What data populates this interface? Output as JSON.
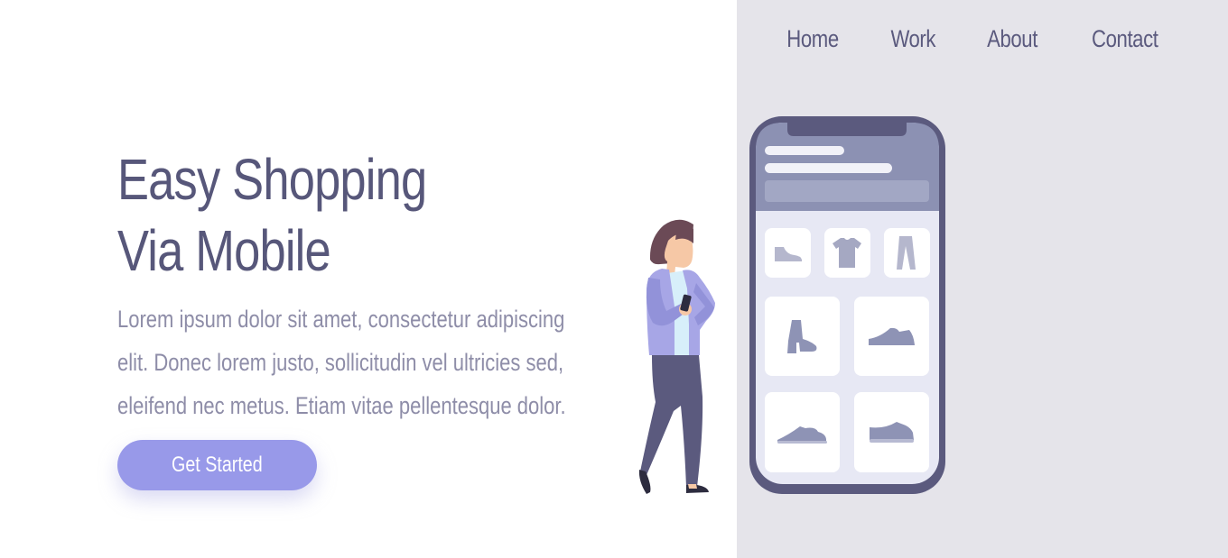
{
  "nav": {
    "items": [
      {
        "label": "Home"
      },
      {
        "label": "Work"
      },
      {
        "label": "About"
      },
      {
        "label": "Contact"
      }
    ]
  },
  "hero": {
    "title_line1": "Easy Shopping",
    "title_line2": "Via Mobile",
    "description": "Lorem ipsum dolor sit amet, consectetur adipiscing elit. Donec lorem justo, sollicitudin vel ultricies sed, eleifend nec metus. Etiam vitae pellentesque dolor.",
    "cta_label": "Get Started"
  },
  "illustration": {
    "person_icon": "woman-with-phone-icon",
    "phone_icon": "smartphone-shop-icon",
    "category_icons": [
      "shoe-icon",
      "tshirt-icon",
      "pants-icon"
    ],
    "product_icons": [
      "boot-icon",
      "sneaker-icon",
      "sneaker-icon",
      "sneaker-icon"
    ]
  },
  "colors": {
    "accent": "#9899e9",
    "text_dark": "#57577a",
    "text_muted": "#8e8da8",
    "panel_bg": "#e5e4ea",
    "phone_frame": "#5b5a7e"
  }
}
